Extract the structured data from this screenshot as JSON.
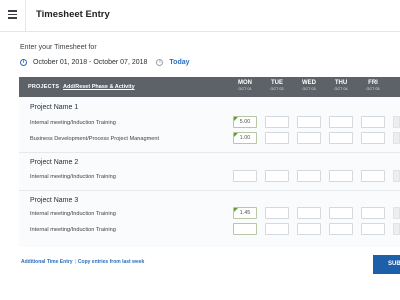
{
  "header": {
    "title": "Timesheet Entry",
    "menu_icon": "hamburger-menu-icon"
  },
  "intro": {
    "prompt": "Enter your Timesheet for",
    "date_range": "October 01, 2018 - October 07, 2018",
    "today_label": "Today",
    "info_icon": "i"
  },
  "table": {
    "projects_label": "PROJECTS",
    "add_label": "Add/Reset Phase & Activity",
    "days": [
      {
        "name": "MON",
        "date": "OCT 01"
      },
      {
        "name": "TUE",
        "date": "OCT 02"
      },
      {
        "name": "WED",
        "date": "OCT 03"
      },
      {
        "name": "THU",
        "date": "OCT 04"
      },
      {
        "name": "FRI",
        "date": "OCT 05"
      }
    ],
    "projects": [
      {
        "name": "Project Name 1",
        "rows": [
          {
            "label": "Internal meeting/Induction Training",
            "mon": "5.00"
          },
          {
            "label": "Business Development/Process Project Managment",
            "mon": "1.00"
          }
        ]
      },
      {
        "name": "Project Name 2",
        "rows": [
          {
            "label": "Internal meeting/Induction Training",
            "mon": ""
          }
        ]
      },
      {
        "name": "Project Name 3",
        "rows": [
          {
            "label": "Internal meeting/Induction Training",
            "mon": "1.45"
          },
          {
            "label": "Internal meeting/Induction Training",
            "mon": ""
          }
        ]
      }
    ]
  },
  "footer": {
    "additional_entry": "Additional Time Entry",
    "copy_entries": "Copy entries from last week",
    "submit_label": "SUBMIT"
  },
  "colors": {
    "header_bg": "#5d6268",
    "accent": "#2c6fbd",
    "submit_bg": "#1d5fa8",
    "filled_flag": "#5aa02c"
  }
}
